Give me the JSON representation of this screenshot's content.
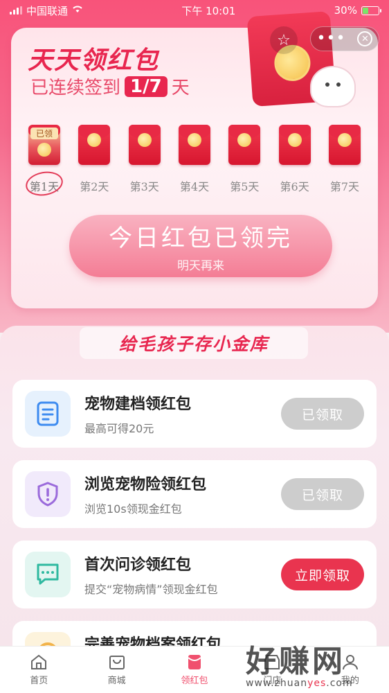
{
  "status_bar": {
    "carrier": "中国联通",
    "time": "下午 10:01",
    "battery": "30%"
  },
  "hero": {
    "title": "天天领红包",
    "streak_prefix": "已连续签到",
    "streak_value": "1/7",
    "streak_suffix": "天",
    "claimed_tag": "已领",
    "days": [
      "第1天",
      "第2天",
      "第3天",
      "第4天",
      "第5天",
      "第6天",
      "第7天"
    ],
    "done_main": "今日红包已领完",
    "done_sub": "明天再来"
  },
  "section": {
    "title": "给毛孩子存小金库"
  },
  "tasks": [
    {
      "title": "宠物建档领红包",
      "desc": "最高可得20元",
      "button": "已领取",
      "icon": "document-icon",
      "accent": "#3d8bf0"
    },
    {
      "title": "浏览宠物险领红包",
      "desc": "浏览10s领现金红包",
      "button": "已领取",
      "icon": "shield-alert-icon",
      "accent": "#9b6bdb"
    },
    {
      "title": "首次问诊领红包",
      "desc": "提交“宠物病情”领现金红包",
      "button": "立即领取",
      "icon": "chat-icon",
      "accent": "#2fb9a0"
    },
    {
      "title": "完善宠物档案领红包",
      "desc": "",
      "button": "",
      "icon": "coin-icon",
      "accent": "#f2b34a"
    }
  ],
  "tabbar": {
    "items": [
      {
        "label": "首页",
        "icon": "home-icon"
      },
      {
        "label": "商城",
        "icon": "shop-icon"
      },
      {
        "label": "领红包",
        "icon": "red-envelope-icon"
      },
      {
        "label": "门店",
        "icon": "store-icon"
      },
      {
        "label": "我的",
        "icon": "user-icon"
      }
    ]
  },
  "watermark": {
    "big": "好赚网",
    "small_pre": "www.zhuan",
    "small_hi": "yes",
    "small_post": ".com"
  },
  "colors": {
    "brand_red": "#e8264f",
    "button_red": "#e9344f",
    "button_gray": "#cdcdcd"
  }
}
